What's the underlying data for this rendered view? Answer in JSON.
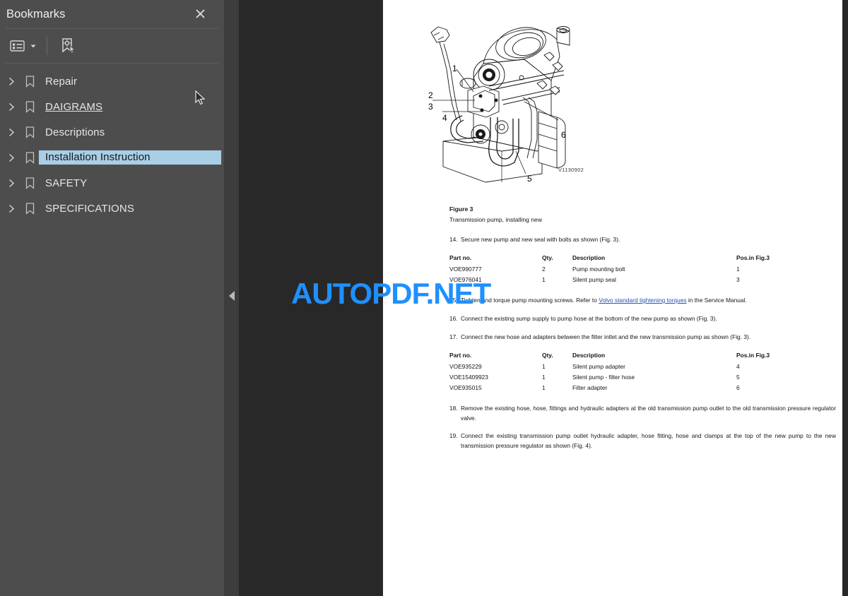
{
  "sidebar": {
    "title": "Bookmarks",
    "close_icon": "close-icon",
    "toolbar": [
      {
        "name": "bookmark-options-icon",
        "label": "Bookmark options"
      },
      {
        "name": "new-bookmark-icon",
        "label": "New bookmark"
      }
    ],
    "items": [
      {
        "label": "Repair",
        "selected": false,
        "underlined": false
      },
      {
        "label": "DAIGRAMS",
        "selected": false,
        "underlined": true
      },
      {
        "label": "Descriptions",
        "selected": false,
        "underlined": false
      },
      {
        "label": "Installation Instruction",
        "selected": true,
        "underlined": false
      },
      {
        "label": "SAFETY",
        "selected": false,
        "underlined": false
      },
      {
        "label": "SPECIFICATIONS",
        "selected": false,
        "underlined": false
      }
    ]
  },
  "splitter": {
    "collapse_icon": "collapse-left-icon"
  },
  "watermark": {
    "text": "AUTOPDF.NET",
    "color": "#1e90ff"
  },
  "document": {
    "figure": {
      "reference_code": "V1130902",
      "callouts": [
        "1",
        "2",
        "3",
        "4",
        "5",
        "6"
      ],
      "caption_title": "Figure 3",
      "caption_subtitle": "Transmission pump, installing new"
    },
    "steps": [
      {
        "number": "14.",
        "text": "Secure new pump and new seal with bolts as shown (Fig. 3)."
      },
      {
        "number": "15.",
        "text_before_link": "Tighten and torque pump mounting screws. Refer to ",
        "link_text": "Volvo standard tightening torques",
        "text_after_link": " in the Service Manual."
      },
      {
        "number": "16.",
        "text": "Connect the existing sump supply to pump hose at the bottom of the new pump as shown (Fig. 3)."
      },
      {
        "number": "17.",
        "text": "Connect the new hose and adapters between the filter intlet and the new transmission pump as shown (Fig. 3)."
      },
      {
        "number": "18.",
        "text": "Remove the existing hose, hose, fittings and hydraulic adapters at the old transmission pump outlet to the old transmission pressure regulator valve."
      },
      {
        "number": "19.",
        "text": "Connect the existing transmission pump outlet hydraulic adapter, hose fitting, hose and clamps at the top of the new pump to the new transmission pressure regulator as shown (Fig. 4)."
      }
    ],
    "tables": [
      {
        "headers": [
          "Part no.",
          "Qty.",
          "Description",
          "Pos.in Fig.3"
        ],
        "rows": [
          [
            "VOE990777",
            "2",
            "Pump mounting bolt",
            "1"
          ],
          [
            "VOE976041",
            "1",
            "Silent pump seal",
            "3"
          ]
        ]
      },
      {
        "headers": [
          "Part no.",
          "Qty.",
          "Description",
          "Pos.in Fig.3"
        ],
        "rows": [
          [
            "VOE935229",
            "1",
            "Silent pump adapter",
            "4"
          ],
          [
            "VOE15409923",
            "1",
            "Silent pump - filter hose",
            "5"
          ],
          [
            "VOE935015",
            "1",
            "Filter adapter",
            "6"
          ]
        ]
      }
    ]
  }
}
